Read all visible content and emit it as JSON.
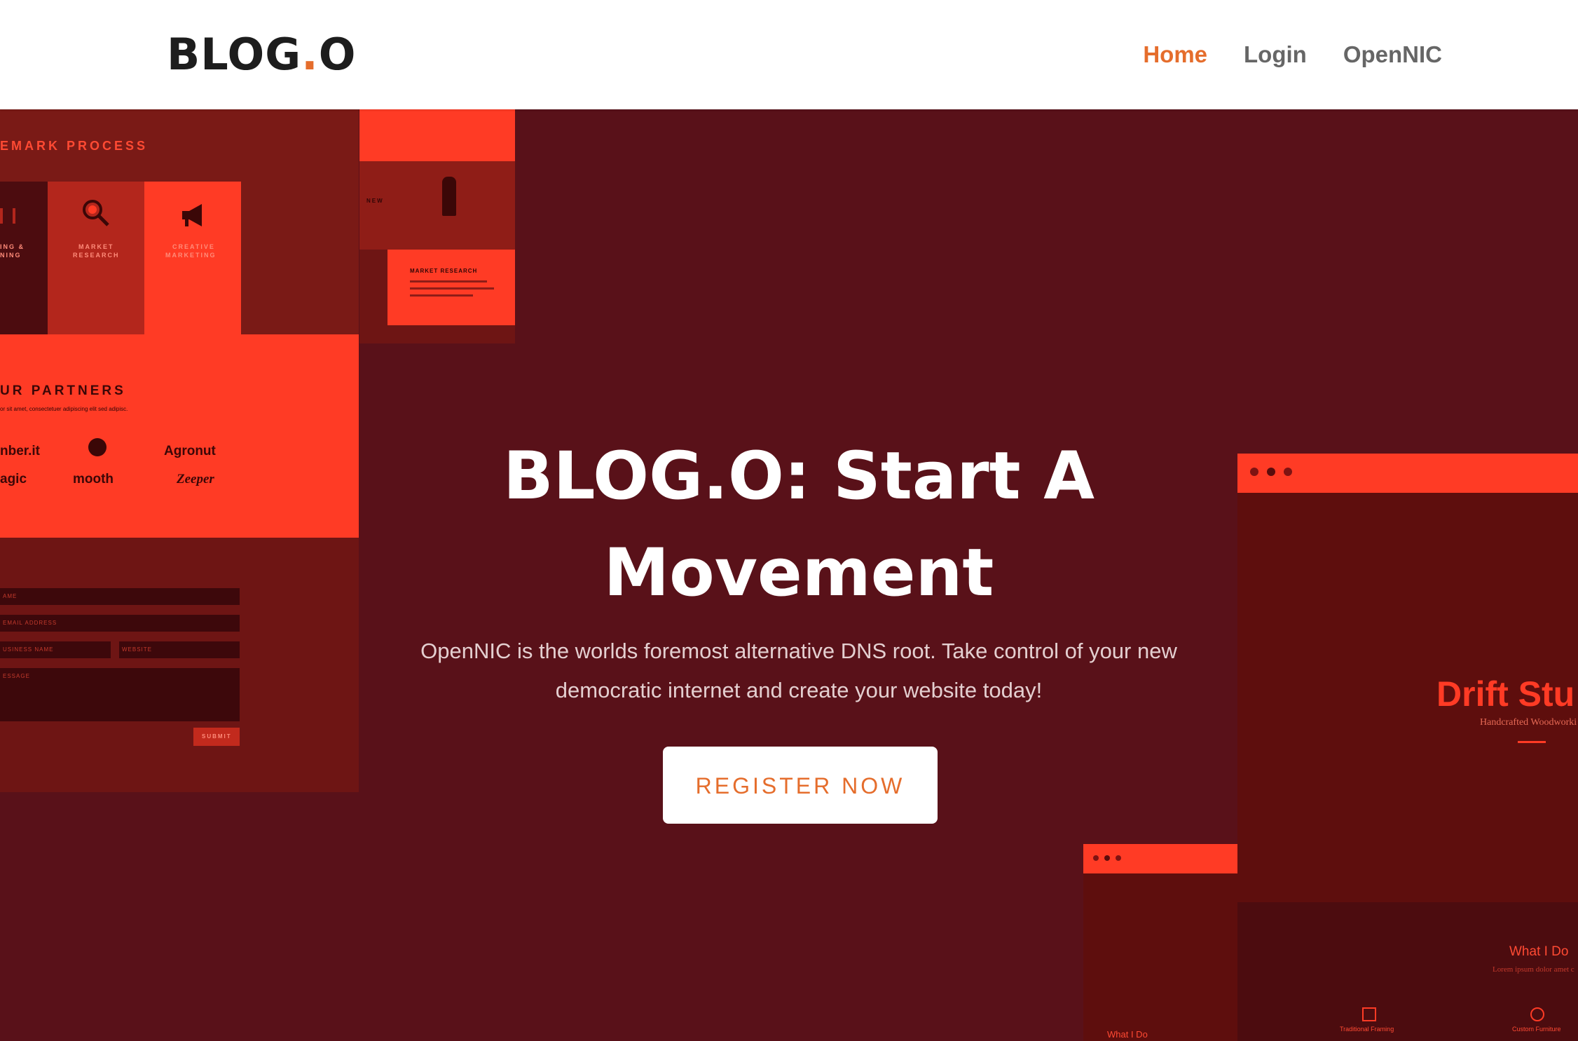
{
  "header": {
    "logo": {
      "text": "BLOG",
      "dot": ".",
      "suffix": "O"
    },
    "nav": [
      {
        "label": "Home",
        "active": true
      },
      {
        "label": "Login",
        "active": false
      },
      {
        "label": "OpenNIC",
        "active": false
      }
    ]
  },
  "hero": {
    "title_line1": "BLOG.O: Start A",
    "title_line2": "Movement",
    "subtitle": "OpenNIC is the worlds foremost alternative DNS root. Take control of your new democratic internet and create your website today!",
    "cta_label": "REGISTER NOW"
  },
  "mockups": {
    "left": {
      "process_title": "EMARK PROCESS",
      "col1_title": "ING &",
      "col1_title2": "NING",
      "col2_title": "MARKET",
      "col2_title2": "RESEARCH",
      "col3_title": "CREATIVE",
      "col3_title2": "MARKETING",
      "partners_title": "UR PARTNERS",
      "partners_caption": "or sit amet, consectetuer adipiscing elit sed adipisc.",
      "partner_logos": [
        "nber.it",
        "Agronut",
        "agic",
        "mooth",
        "Zeeper"
      ],
      "form_fields": [
        "AME",
        "EMAIL ADDRESS",
        "USINESS NAME",
        "WEBSITE",
        "ESSAGE"
      ],
      "submit": "SUBMIT"
    },
    "top_center": {
      "label_new": "NEW",
      "label_market": "MARKET RESEARCH"
    },
    "right": {
      "drift_title": "Drift Stu",
      "drift_sub": "Handcrafted Woodworki",
      "what_i_do": "What I Do",
      "what_i_do_small": "What I Do",
      "lorem": "Lorem ipsum dolor amet c",
      "feature1": "Traditional Framing",
      "feature2": "Custom Furniture"
    }
  },
  "colors": {
    "accent": "#e56d2c",
    "hero_bg": "#591119",
    "mock_red": "#ff3b25"
  }
}
